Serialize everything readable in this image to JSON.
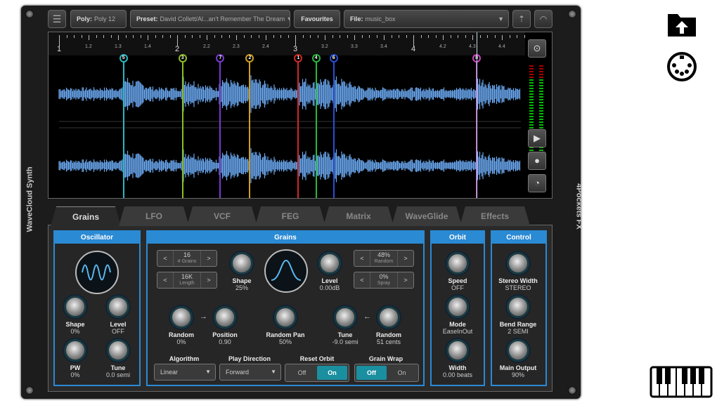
{
  "app": {
    "left_label": "WaveCloud Synth",
    "right_label": "4Pockets FX"
  },
  "toolbar": {
    "menu_icon": "hamburger-icon",
    "poly_label": "Poly:",
    "poly_value": "Poly 12",
    "preset_label": "Preset:",
    "preset_value": "David Collett/Al...an't Remember The Dream",
    "favourites": "Favourites",
    "file_label": "File:",
    "file_value": "music_box",
    "upload_icon": "upload-icon",
    "gauge_icon": "gauge-icon"
  },
  "ruler": {
    "major": [
      "1",
      "2",
      "3",
      "4"
    ],
    "minor": [
      "1.2",
      "1.3",
      "1.4",
      "2.2",
      "2.3",
      "2.4",
      "3.2",
      "3.3",
      "3.4",
      "4.2",
      "4.3",
      "4.4"
    ]
  },
  "markers": [
    {
      "id": "5",
      "pos": 1.54,
      "color": "#2ab8c0"
    },
    {
      "id": "3",
      "pos": 2.04,
      "color": "#8ac020"
    },
    {
      "id": "7",
      "pos": 2.36,
      "color": "#7a3ad0"
    },
    {
      "id": "2",
      "pos": 2.61,
      "color": "#d0a020"
    },
    {
      "id": "1",
      "pos": 3.02,
      "color": "#d02828"
    },
    {
      "id": "4",
      "pos": 3.17,
      "color": "#28b840"
    },
    {
      "id": "6",
      "pos": 3.32,
      "color": "#2850d8"
    },
    {
      "id": "8",
      "pos": 4.53,
      "color": "#d040c0"
    }
  ],
  "waveform_color": "#6aa8f0",
  "tabs": [
    "Grains",
    "LFO",
    "VCF",
    "FEG",
    "Matrix",
    "WaveGlide",
    "Effects"
  ],
  "active_tab": "Grains",
  "oscillator": {
    "title": "Oscillator",
    "knobs": [
      {
        "label": "Shape",
        "value": "0%"
      },
      {
        "label": "Level",
        "value": "OFF"
      },
      {
        "label": "PW",
        "value": "0%"
      },
      {
        "label": "Tune",
        "value": "0.0 semi"
      }
    ]
  },
  "grains": {
    "title": "Grains",
    "steppers": [
      {
        "value": "16",
        "label": "# Grains"
      },
      {
        "value": "16K",
        "label": "Length"
      },
      {
        "value": "48%",
        "label": "Random"
      },
      {
        "value": "0%",
        "label": "Spray"
      }
    ],
    "shape": {
      "label": "Shape",
      "value": "25%"
    },
    "level": {
      "label": "Level",
      "value": "0.00dB"
    },
    "row2": [
      {
        "label": "Random",
        "value": "0%"
      },
      {
        "label": "Position",
        "value": "0.90"
      },
      {
        "label": "Random Pan",
        "value": "50%"
      },
      {
        "label": "Tune",
        "value": "-9.0 semi"
      },
      {
        "label": "Random",
        "value": "51 cents"
      }
    ],
    "algorithm": {
      "label": "Algorithm",
      "value": "Linear"
    },
    "play_direction": {
      "label": "Play Direction",
      "value": "Forward"
    },
    "reset_orbit": {
      "label": "Reset Orbit",
      "off": "Off",
      "on": "On",
      "state": "On"
    },
    "grain_wrap": {
      "label": "Grain Wrap",
      "off": "Off",
      "on": "On",
      "state": "Off"
    }
  },
  "orbit": {
    "title": "Orbit",
    "knobs": [
      {
        "label": "Speed",
        "value": "OFF"
      },
      {
        "label": "Mode",
        "value": "EaseInOut"
      },
      {
        "label": "Width",
        "value": "0.00 beats"
      }
    ]
  },
  "control": {
    "title": "Control",
    "knobs": [
      {
        "label": "Stereo Width",
        "value": "STEREO"
      },
      {
        "label": "Bend Range",
        "value": "2 SEMI"
      },
      {
        "label": "Main Output",
        "value": "90%"
      }
    ]
  },
  "accent": "#2a8ad4"
}
